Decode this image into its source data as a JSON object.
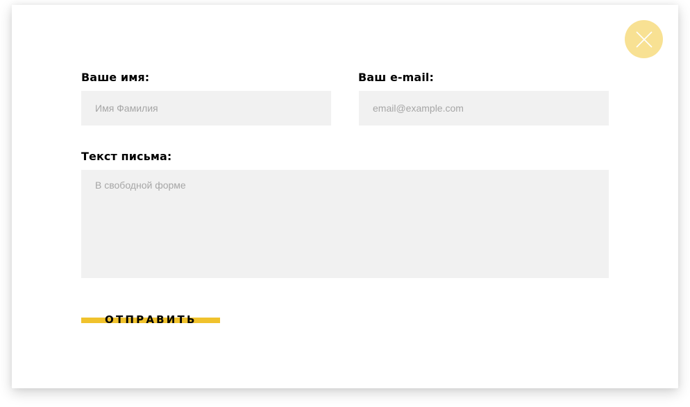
{
  "form": {
    "name_label": "Ваше имя:",
    "name_placeholder": "Имя Фамилия",
    "email_label": "Ваш e-mail:",
    "email_placeholder": "email@example.com",
    "message_label": "Текст письма:",
    "message_placeholder": "В свободной форме",
    "submit_label": "ОТПРАВИТЬ"
  },
  "close_button": {
    "icon": "close-icon"
  },
  "colors": {
    "accent_yellow": "#f0c22d",
    "close_circle": "#f8e193",
    "field_background": "#f1f1f1",
    "placeholder_text": "#a6a6a6"
  }
}
